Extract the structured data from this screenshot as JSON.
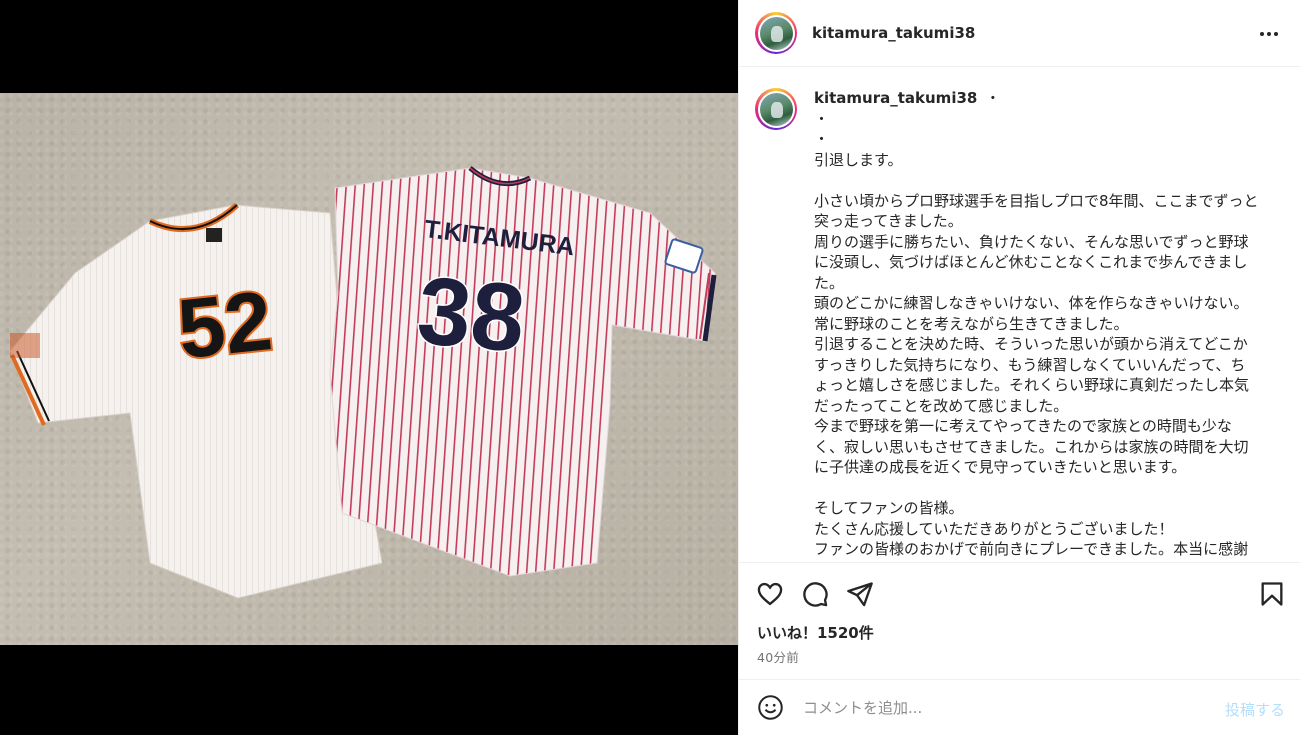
{
  "post": {
    "username": "kitamura_takumi38",
    "more_icon": "more-horizontal-icon"
  },
  "caption": {
    "username": "kitamura_takumi38",
    "separator": "・",
    "lines": [
      "・",
      "・",
      "引退します。",
      "",
      "小さい頃からプロ野球選手を目指しプロで8年間、ここまでずっと",
      "突っ走ってきました。",
      "周りの選手に勝ちたい、負けたくない、そんな思いでずっと野球",
      "に没頭し、気づけばほとんど休むことなくこれまで歩んできまし",
      "た。",
      "頭のどこかに練習しなきゃいけない、体を作らなきゃいけない。",
      "常に野球のことを考えながら生きてきました。",
      "引退することを決めた時、そういった思いが頭から消えてどこか",
      "すっきりした気持ちになり、もう練習しなくていいんだって、ち",
      "ょっと嬉しさを感じました。それくらい野球に真剣だったし本気",
      "だったってことを改めて感じました。",
      "今まで野球を第一に考えてやってきたので家族との時間も少な",
      "く、寂しい思いもさせてきました。これからは家族の時間を大切",
      "に子供達の成長を近くで見守っていきたいと思います。",
      "",
      "そしてファンの皆様。",
      "たくさん応援していただきありがとうございました！",
      "ファンの皆様のおかげで前向きにプレーできました。本当に感謝"
    ]
  },
  "photo": {
    "jersey_left_number": "52",
    "jersey_right_name": "T.KITAMURA",
    "jersey_right_number": "38"
  },
  "actions": {
    "like_icon": "heart-icon",
    "comment_icon": "comment-icon",
    "share_icon": "share-icon",
    "save_icon": "bookmark-icon"
  },
  "likes_text": "いいね！1520件",
  "time_text": "40分前",
  "comment_box": {
    "emoji_icon": "emoji-icon",
    "placeholder": "コメントを追加...",
    "post_label": "投稿する"
  },
  "colors": {
    "accent": "#0095f6",
    "post_disabled": "#b2dffc",
    "secondary_text": "#737373"
  }
}
